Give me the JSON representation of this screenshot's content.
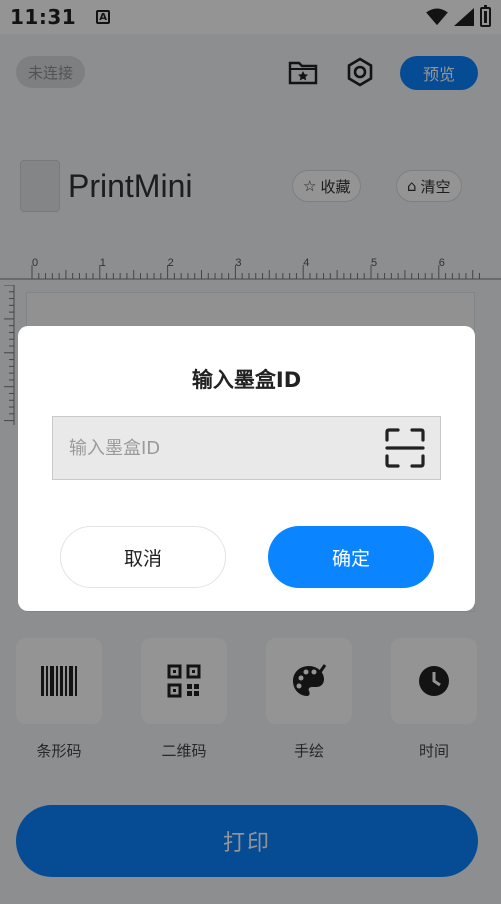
{
  "status_bar": {
    "time": "11:31",
    "notification_icon": "A"
  },
  "topbar": {
    "connection_status": "未连接",
    "preview_label": "预览"
  },
  "brand": {
    "app_name": "PrintMini"
  },
  "actions": {
    "favorites_label": "收藏",
    "clear_label": "清空"
  },
  "ruler": {
    "ticks": [
      "0",
      "1",
      "2",
      "3",
      "4",
      "5",
      "6"
    ]
  },
  "tools": [
    {
      "label": "条形码",
      "icon": "barcode-icon"
    },
    {
      "label": "二维码",
      "icon": "qrcode-icon"
    },
    {
      "label": "手绘",
      "icon": "palette-icon"
    },
    {
      "label": "时间",
      "icon": "clock-icon"
    }
  ],
  "print": {
    "label": "打印"
  },
  "dialog": {
    "title": "输入墨盒ID",
    "input_placeholder": "输入墨盒ID",
    "input_value": "",
    "cancel_label": "取消",
    "confirm_label": "确定"
  },
  "colors": {
    "accent": "#0a84ff",
    "scrim": "rgba(0,0,0,0.42)"
  }
}
